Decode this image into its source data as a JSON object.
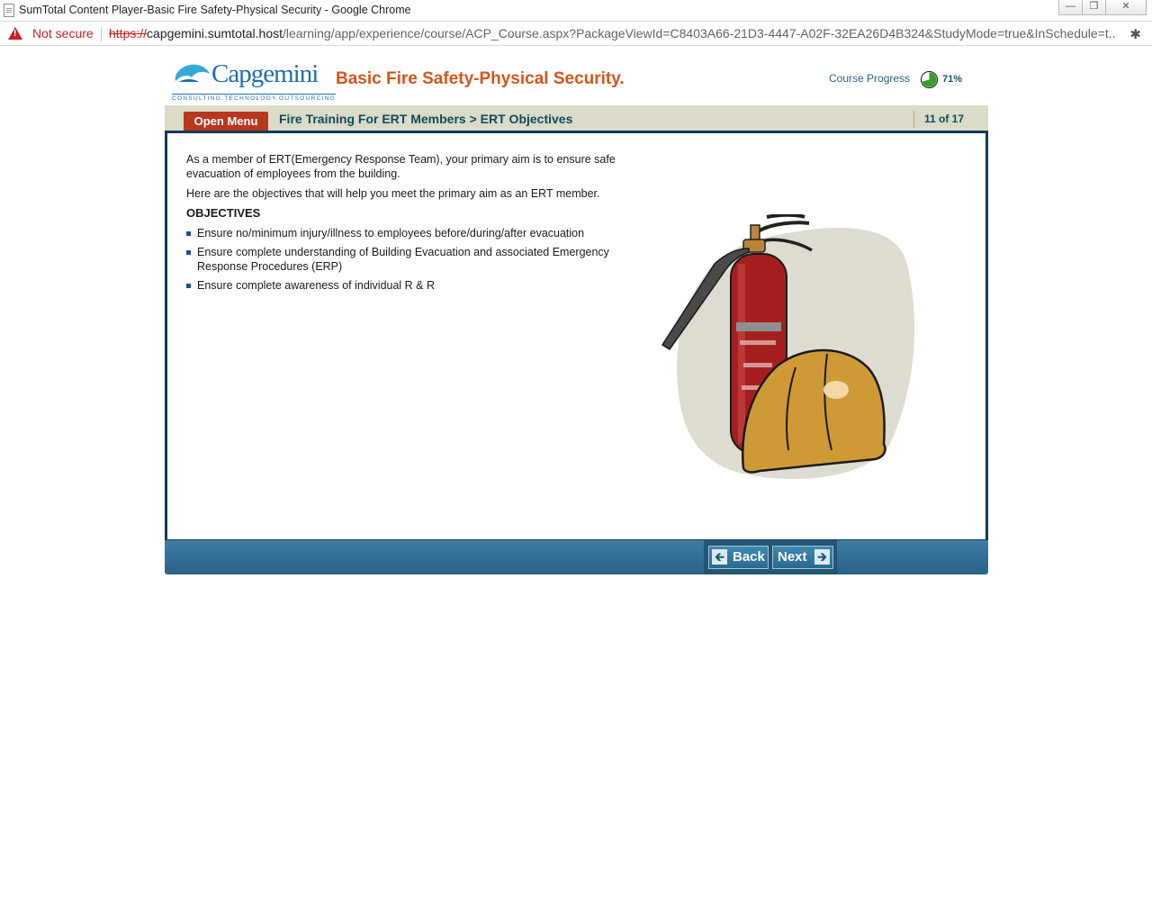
{
  "browser": {
    "window_title": "SumTotal Content Player-Basic Fire Safety-Physical Security - Google Chrome",
    "security_label": "Not secure",
    "url_scheme": "https://",
    "url_host": "capgemini.sumtotal.host",
    "url_path": "/learning/app/experience/course/ACP_Course.aspx?PackageViewId=C8403A66-21D3-4447-A02F-32EA26D4B324&StudyMode=true&InSchedule=t..."
  },
  "header": {
    "logo_text": "Capgemini",
    "logo_tagline": "CONSULTING.TECHNOLOGY.OUTSOURCING",
    "course_title": "Basic Fire Safety-Physical Security.",
    "progress_label": "Course Progress",
    "progress_value": "71%",
    "progress_fraction": 0.71
  },
  "navigation": {
    "open_menu_label": "Open Menu",
    "breadcrumb": "Fire Training For ERT Members > ERT Objectives",
    "page_count": "11 of 17"
  },
  "content": {
    "intro": "As a member of ERT(Emergency Response Team), your primary aim is to ensure safe evacuation of employees from the building.",
    "objectives_intro": "Here are the objectives that will help you meet the primary aim as an ERT member.",
    "objectives_heading": "OBJECTIVES",
    "objectives": [
      "Ensure no/minimum injury/illness to employees before/during/after evacuation",
      "Ensure complete understanding of Building Evacuation and associated Emergency Response Procedures (ERP)",
      "Ensure complete awareness of individual R & R"
    ]
  },
  "footer": {
    "back_label": "Back",
    "next_label": "Next"
  },
  "colors": {
    "brand_blue": "#1e6fae",
    "title_orange": "#d4551c",
    "menu_red": "#b8371e",
    "nav_beige": "#dbdbc8",
    "frame_navy": "#123c56",
    "footer_blue": "#2a6187",
    "progress_green": "#3a9a2a"
  },
  "icons": {
    "warning": "warning-triangle-icon",
    "extension": "puzzle-piece-icon",
    "back_arrow": "arrow-left-icon",
    "next_arrow": "arrow-right-icon"
  }
}
